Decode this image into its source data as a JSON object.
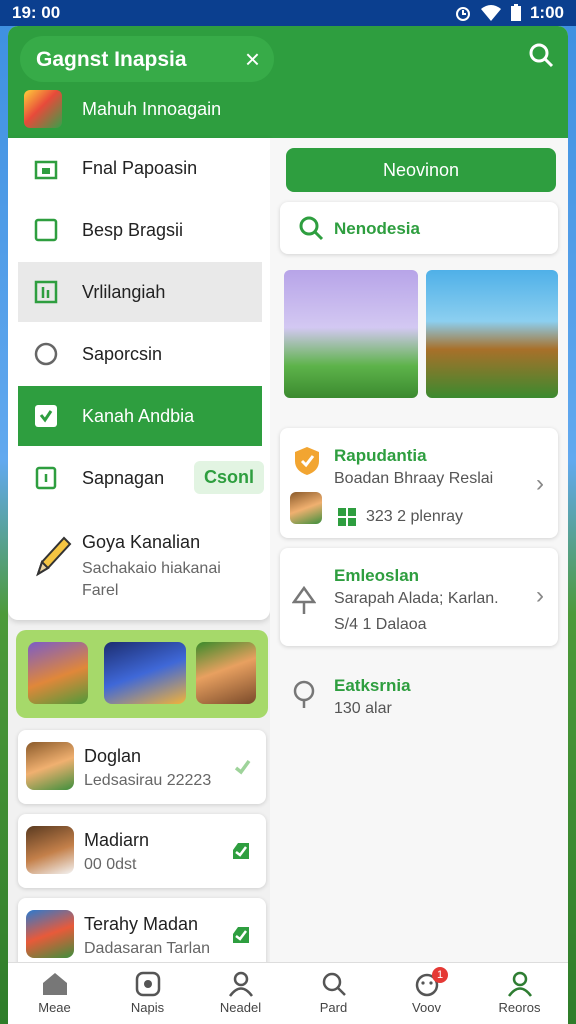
{
  "status_bar": {
    "time": "19: 00",
    "battery_time": "1:00"
  },
  "app_bar": {
    "search_text": "Gagnst Inapsia",
    "app_name": "Mahuh Innoagain"
  },
  "left_menu": {
    "items": [
      {
        "label": "Fnal Papoasin",
        "icon": "store-icon"
      },
      {
        "label": "Besp Bragsii",
        "icon": "square-icon"
      },
      {
        "label": "Vrlilangiah",
        "icon": "bars-icon"
      },
      {
        "label": "Saporcsin",
        "icon": "circle-icon"
      },
      {
        "label": "Kanah Andbia",
        "icon": "shield-check-icon"
      },
      {
        "label": "Sapnagan",
        "icon": "doc-icon",
        "badge": "Csonl"
      }
    ],
    "pencil_item": {
      "title": "Goya Kanalian",
      "subtitle": "Sachakaio hiakanai Farel"
    }
  },
  "games": [
    {
      "title": "Doglan",
      "subtitle": "Ledsasirau 22223"
    },
    {
      "title": "Madiarn",
      "subtitle": "00 0dst"
    },
    {
      "title": "Terahy Madan",
      "subtitle": "Dadasaran Tarlan"
    }
  ],
  "right": {
    "nav_button": "Neovinon",
    "search_label": "Nenodesia",
    "cards": [
      {
        "title": "Rapudantia",
        "line1": "Boadan Bhraay Reslai",
        "line2": "323 2 plenray"
      },
      {
        "title": "Emleoslan",
        "line1": "Sarapah Alada; Karlan.",
        "line2": "S/4 1 Dalaoa"
      },
      {
        "title": "Eatksrnia",
        "line1": "130 alar"
      }
    ]
  },
  "bottom_tabs": [
    {
      "label": "Meae",
      "icon": "home-icon"
    },
    {
      "label": "Napis",
      "icon": "apps-icon"
    },
    {
      "label": "Neadel",
      "icon": "profile-icon"
    },
    {
      "label": "Pard",
      "icon": "search-icon"
    },
    {
      "label": "Voov",
      "icon": "face-icon",
      "badge": "1"
    },
    {
      "label": "Reoros",
      "icon": "user-icon"
    }
  ],
  "colors": {
    "brand_green": "#2e9e3f",
    "status_bar": "#0b3f8f"
  }
}
